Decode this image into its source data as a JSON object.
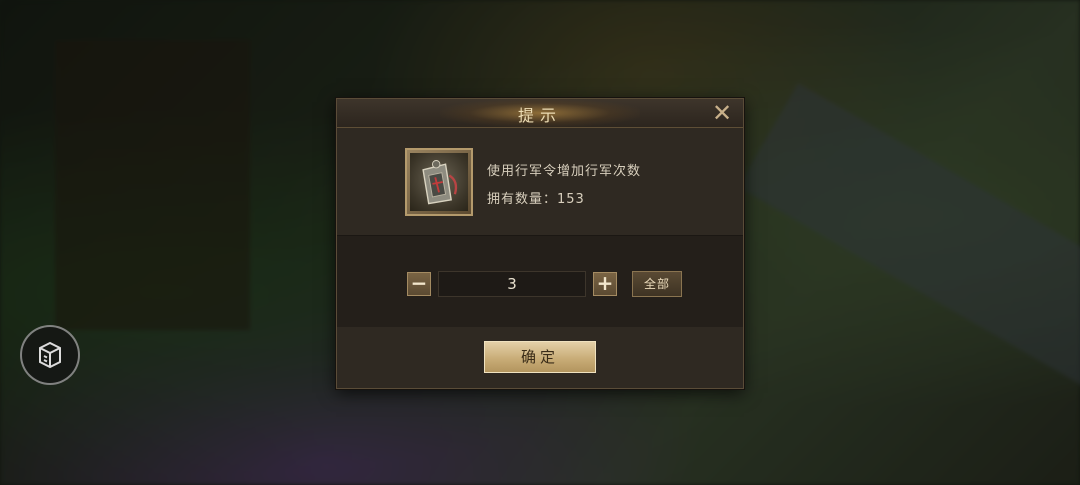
{
  "dialog": {
    "title": "提示",
    "close_icon": "close-icon",
    "item_icon": "march-order-token-icon",
    "description": "使用行军令增加行军次数",
    "owned_label": "拥有数量：",
    "owned_count": "153",
    "quantity_value": "3",
    "minus_label": "−",
    "plus_label": "+",
    "all_label": "全部",
    "confirm_label": "确定"
  },
  "side_button": {
    "icon": "chest-menu-icon"
  },
  "colors": {
    "title_text": "#ecdcb4",
    "confirm_bg": "#d8c193",
    "dialog_bg": "#2b2520"
  }
}
